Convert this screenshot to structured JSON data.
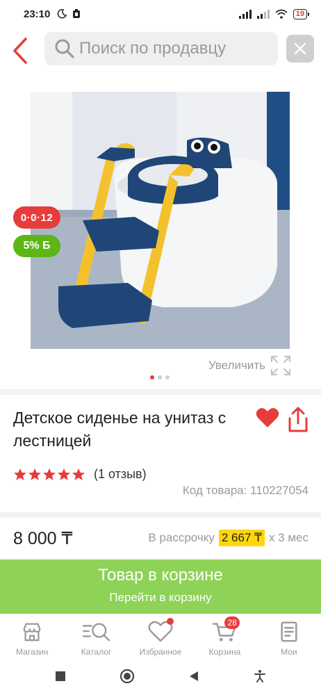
{
  "status_bar": {
    "time": "23:10",
    "battery": "19"
  },
  "header": {
    "search_placeholder": "Поиск по продавцу"
  },
  "product": {
    "image_alt": "Детское сиденье на унитаз с лестницей",
    "badges": {
      "installment": "0·0·12",
      "bonus": "5% Б"
    },
    "zoom_label": "Увеличить",
    "gallery_dots": 3,
    "gallery_active": 0,
    "title": "Детское сиденье на унитаз с лестницей",
    "rating_stars": 5,
    "reviews": "(1 отзыв)",
    "code": "Код товара: 110227054",
    "price": "8 000 ₸",
    "installment_prefix": "В рассрочку",
    "installment_amount": "2 667 ₸",
    "installment_suffix": "x 3 мес"
  },
  "cart_banner": {
    "title": "Товар в корзине",
    "subtitle": "Перейти в корзину"
  },
  "tabs": [
    {
      "label": "Магазин",
      "icon": "store-icon"
    },
    {
      "label": "Каталог",
      "icon": "catalog-search-icon"
    },
    {
      "label": "Избранное",
      "icon": "heart-icon"
    },
    {
      "label": "Корзина",
      "icon": "cart-icon",
      "badge": "28"
    },
    {
      "label": "Мои",
      "icon": "orders-icon"
    }
  ],
  "colors": {
    "accent_red": "#e73c3c",
    "bonus_green": "#5cb613",
    "cart_green": "#8ed257",
    "installment_yellow": "#ffd60a"
  }
}
